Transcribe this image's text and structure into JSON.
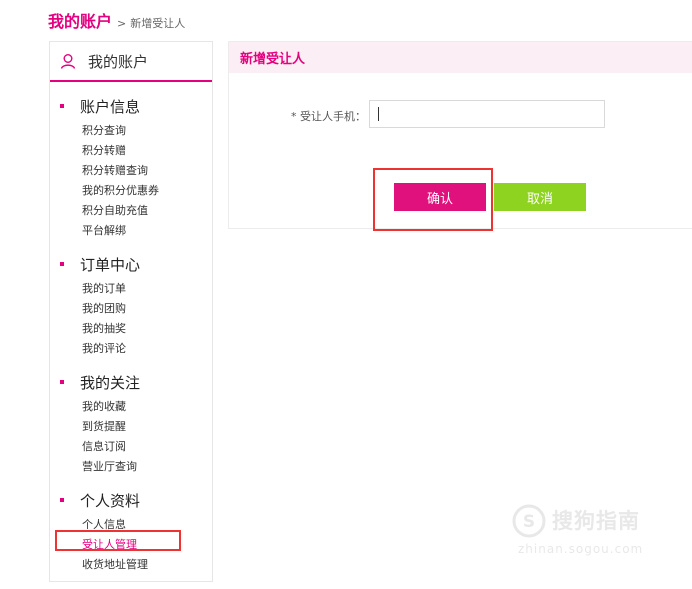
{
  "breadcrumb": {
    "root": "我的账户",
    "separator": ">",
    "current": "新增受让人"
  },
  "sidebar": {
    "title": "我的账户",
    "groups": [
      {
        "title": "账户信息",
        "items": [
          "积分查询",
          "积分转赠",
          "积分转赠查询",
          "我的积分优惠券",
          "积分自助充值",
          "平台解绑"
        ]
      },
      {
        "title": "订单中心",
        "items": [
          "我的订单",
          "我的团购",
          "我的抽奖",
          "我的评论"
        ]
      },
      {
        "title": "我的关注",
        "items": [
          "我的收藏",
          "到货提醒",
          "信息订阅",
          "营业厅查询"
        ]
      },
      {
        "title": "个人资料",
        "items": [
          "个人信息",
          "受让人管理",
          "收货地址管理"
        ]
      }
    ],
    "active_item": "受让人管理"
  },
  "panel": {
    "title": "新增受让人",
    "field_label": "* 受让人手机：",
    "phone_value": "",
    "confirm_label": "确认",
    "cancel_label": "取消"
  },
  "watermark": {
    "text": "搜狗指南",
    "url": "zhinan.sogou.com"
  },
  "colors": {
    "accent": "#e4007f",
    "confirm": "#e0117c",
    "cancel": "#8fd321",
    "highlight": "#e33333"
  },
  "icons": {
    "sidebar_header": "user-icon",
    "watermark_logo": "sogou-logo"
  }
}
